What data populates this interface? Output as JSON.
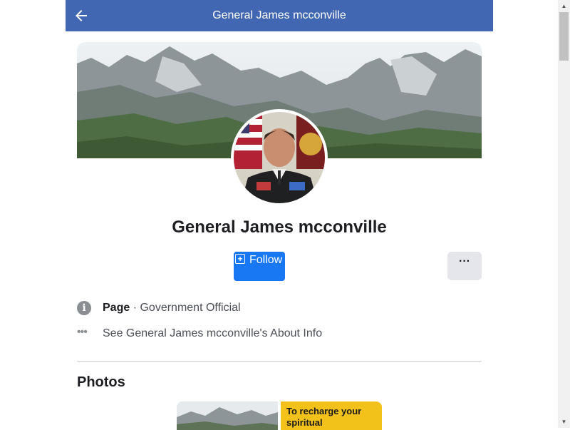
{
  "header": {
    "title": "General James mcconville",
    "back_icon": "arrow-left-icon"
  },
  "profile": {
    "name": "General James mcconville",
    "cover_description": "mountain landscape",
    "avatar": "profile-photo"
  },
  "actions": {
    "follow_label": "Follow",
    "follow_icon": "plus-box-icon",
    "more_label": "···"
  },
  "info": {
    "category_label": "Page",
    "separator": "·",
    "category_value": "Government Official",
    "about_link": "See General James mcconville's About Info"
  },
  "photos": {
    "title": "Photos",
    "thumb2_text": "To recharge your spiritual"
  },
  "colors": {
    "header_bg": "#4267b2",
    "follow_bg": "#1877f2",
    "more_bg": "#e4e6eb"
  }
}
